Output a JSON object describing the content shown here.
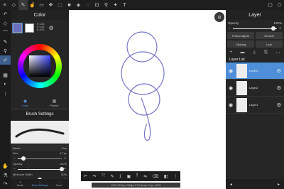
{
  "toolbar": {
    "left_icons": [
      "menu-icon",
      "eraser-icon",
      "brush-icon",
      "smudge-icon",
      "shape-icon",
      "move-icon",
      "select-icon",
      "fill-icon",
      "gradient-icon",
      "lasso-icon",
      "crop-icon",
      "eyedropper-icon",
      "blend-icon",
      "text-icon"
    ],
    "right_icons": [
      "square-icon",
      "cube-icon"
    ]
  },
  "tools": {
    "icons": [
      "undo-icon",
      "eraser-tool-icon",
      "brush-tool-icon",
      "smudge-tool-icon",
      "eyedropper-tool-icon",
      "pencil-tool-icon",
      "bucket-tool-icon",
      "color-tool-icon",
      "grip-icon",
      "hand-icon",
      "pipette-icon",
      "redo-icon"
    ]
  },
  "color_panel": {
    "title": "Color",
    "main_color": "#6a6fbf",
    "sub_color": "#ffffff",
    "rgb_r": "R:128",
    "rgb_g": "G:116",
    "rgb_b": "B:255",
    "mode_tabs": [
      {
        "label": "Color"
      },
      {
        "label": "Palette"
      }
    ]
  },
  "brush_panel": {
    "title": "Brush Settings",
    "name_label": "Name",
    "name_value": "Pen",
    "size_label": "Size",
    "size_value": "6.7px",
    "opacity_label": "Opacity",
    "opacity_value": "100%",
    "opacity_fraction": 1.0,
    "min_width_label": "Minimum Width",
    "min_width_value": "50%",
    "min_width_fraction": 0.5
  },
  "left_bottom_tabs": [
    {
      "label": "Brush"
    },
    {
      "label": "Brush Settings"
    },
    {
      "label": "More"
    }
  ],
  "canvas": {
    "stroke_color": "#7777c6",
    "status_text": "1024*1024px 2048px 87% Brush 4.0px 100%"
  },
  "bottom_bar": {
    "icons": [
      "undo-icon",
      "redo-icon",
      "transform-icon",
      "pen-icon",
      "import-icon",
      "save-icon",
      "export-icon",
      "flip-icon",
      "eraser-icon",
      "mask-icon",
      "more-icon"
    ]
  },
  "layer_panel": {
    "title": "Layer",
    "opacity_label": "Opacity",
    "opacity_value": "100%",
    "protect_alpha": "Protect Alpha",
    "blend_mode": "Normal",
    "clipping": "Clipping",
    "lock": "Lock",
    "list_title": "Layer List",
    "layers": [
      {
        "name": "Layer3",
        "selected": true
      },
      {
        "name": "Layer2",
        "selected": false
      },
      {
        "name": "Layer1",
        "selected": false
      }
    ]
  }
}
